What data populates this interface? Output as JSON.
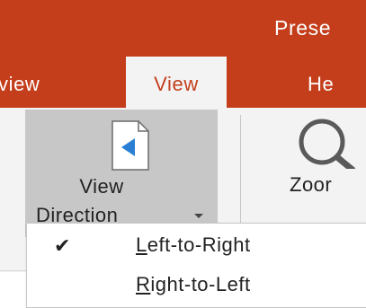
{
  "window": {
    "title": "Prese"
  },
  "tabs": [
    {
      "label": "view",
      "active": false
    },
    {
      "label": "View",
      "active": true
    },
    {
      "label": "He",
      "active": false
    }
  ],
  "ribbon": {
    "view_direction": {
      "label_line1": "View",
      "label_line2": "Direction",
      "icon": "document-left-arrow-icon"
    },
    "zoom": {
      "label": "Zoor",
      "icon": "magnifier-icon"
    }
  },
  "menu": {
    "items": [
      {
        "label": "Left-to-Right",
        "checked": true,
        "check_glyph": "✔"
      },
      {
        "label": "Right-to-Left",
        "checked": false,
        "check_glyph": ""
      }
    ]
  },
  "colors": {
    "accent": "#c43e1c",
    "ribbon_bg": "#f3f3f3",
    "button_pressed": "#c7c7c7",
    "arrow_blue": "#2a7fd4"
  }
}
